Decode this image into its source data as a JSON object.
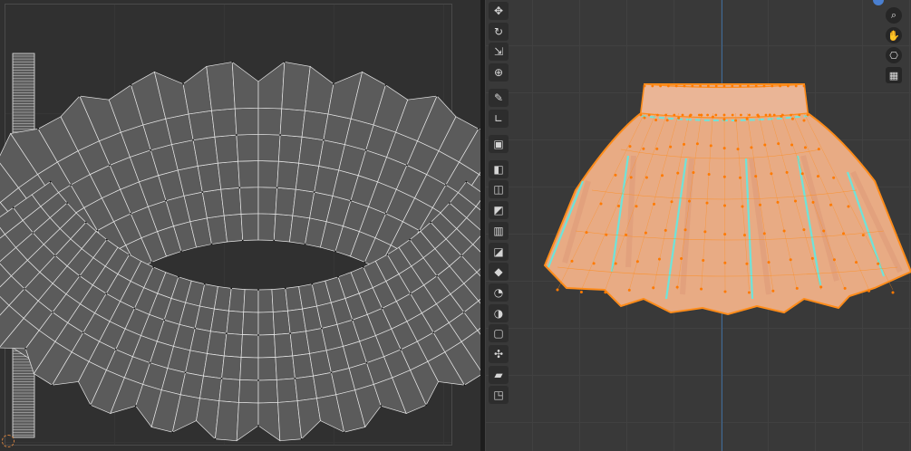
{
  "uv_editor": {
    "origin_icon": "cursor-origin-icon"
  },
  "viewport": {
    "toolbar": [
      {
        "name": "move-tool",
        "icon": "✥"
      },
      {
        "name": "rotate-tool",
        "icon": "↻"
      },
      {
        "name": "scale-tool",
        "icon": "⇲"
      },
      {
        "name": "transform-tool",
        "icon": "⊕"
      },
      {
        "name": "annotate-tool",
        "icon": "✎"
      },
      {
        "name": "measure-tool",
        "icon": "∟"
      },
      {
        "name": "add-cube-tool",
        "icon": "▣"
      },
      {
        "name": "extrude-tool",
        "icon": "◧"
      },
      {
        "name": "inset-tool",
        "icon": "◫"
      },
      {
        "name": "bevel-tool",
        "icon": "◩"
      },
      {
        "name": "loop-cut-tool",
        "icon": "▥"
      },
      {
        "name": "knife-tool",
        "icon": "◪"
      },
      {
        "name": "poly-build-tool",
        "icon": "◆"
      },
      {
        "name": "spin-tool",
        "icon": "◔"
      },
      {
        "name": "smooth-tool",
        "icon": "◑"
      },
      {
        "name": "edge-slide-tool",
        "icon": "▢"
      },
      {
        "name": "shrink-fatten-tool",
        "icon": "✣"
      },
      {
        "name": "shear-tool",
        "icon": "▰"
      },
      {
        "name": "rip-tool",
        "icon": "◳"
      }
    ],
    "nav": [
      {
        "name": "zoom-icon",
        "icon": "⌕"
      },
      {
        "name": "pan-hand-icon",
        "icon": "✋"
      },
      {
        "name": "camera-icon",
        "icon": "⎔"
      },
      {
        "name": "grid-toggle-icon",
        "icon": "▦"
      }
    ],
    "colors": {
      "mesh_fill": "#e8ab84",
      "wire": "#ff8c1a",
      "seam": "#6fe3d9",
      "uv_wire": "#e6e6e6"
    }
  }
}
